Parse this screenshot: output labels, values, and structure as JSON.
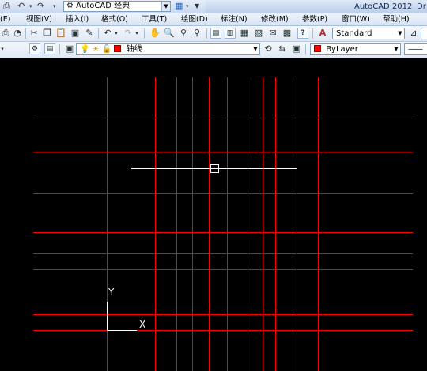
{
  "titlebar": {
    "workspace": "AutoCAD 经典",
    "app_title": "AutoCAD 2012",
    "doc_title_partial": "Dr"
  },
  "menu": {
    "items": [
      "(E)",
      "视图(V)",
      "插入(I)",
      "格式(O)",
      "工具(T)",
      "绘图(D)",
      "标注(N)",
      "修改(M)",
      "参数(P)",
      "窗口(W)",
      "帮助(H)"
    ]
  },
  "toolbar": {
    "text_style": "Standard",
    "layer": "轴线",
    "color": "ByLayer"
  },
  "colors": {
    "axis_lines": "#ff0000",
    "object_line": "#ffffff",
    "canvas_bg": "#000000",
    "layer_swatch": "#ff0000"
  },
  "ucs": {
    "y_label": "Y",
    "x_label": "X"
  }
}
